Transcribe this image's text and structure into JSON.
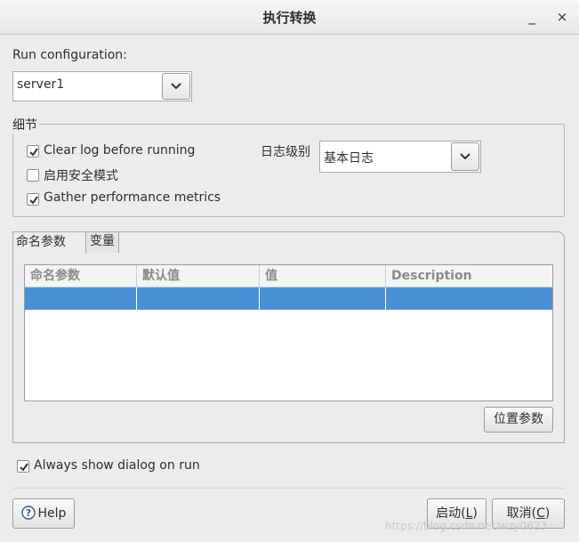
{
  "window": {
    "title": "执行转换",
    "minimize_glyph": "_",
    "close_glyph": "×"
  },
  "run_configuration": {
    "label": "Run configuration:",
    "value": "server1"
  },
  "details": {
    "legend": "细节",
    "clear_log": {
      "label": "Clear log before running",
      "checked": true
    },
    "safe_mode": {
      "label": "启用安全模式",
      "checked": false
    },
    "gather_metrics": {
      "label": "Gather performance metrics",
      "checked": true
    },
    "log_level": {
      "label": "日志级别",
      "value": "基本日志"
    }
  },
  "tabs": [
    {
      "label": "命名参数",
      "active": true
    },
    {
      "label": "变量",
      "active": false
    }
  ],
  "params_table": {
    "columns": [
      "命名参数",
      "默认值",
      "值",
      "Description"
    ],
    "rows": [
      [
        "",
        "",
        "",
        ""
      ]
    ]
  },
  "position_params_button": "位置参数",
  "always_show": {
    "label": "Always show dialog on run",
    "checked": true
  },
  "footer": {
    "help_label": "Help",
    "start_label": "启动(",
    "start_mnemonic": "L",
    "cancel_label": "取消(",
    "cancel_mnemonic": "C",
    "close_paren": ")"
  },
  "watermark": "https://blog.csdn.net/wzy0623"
}
